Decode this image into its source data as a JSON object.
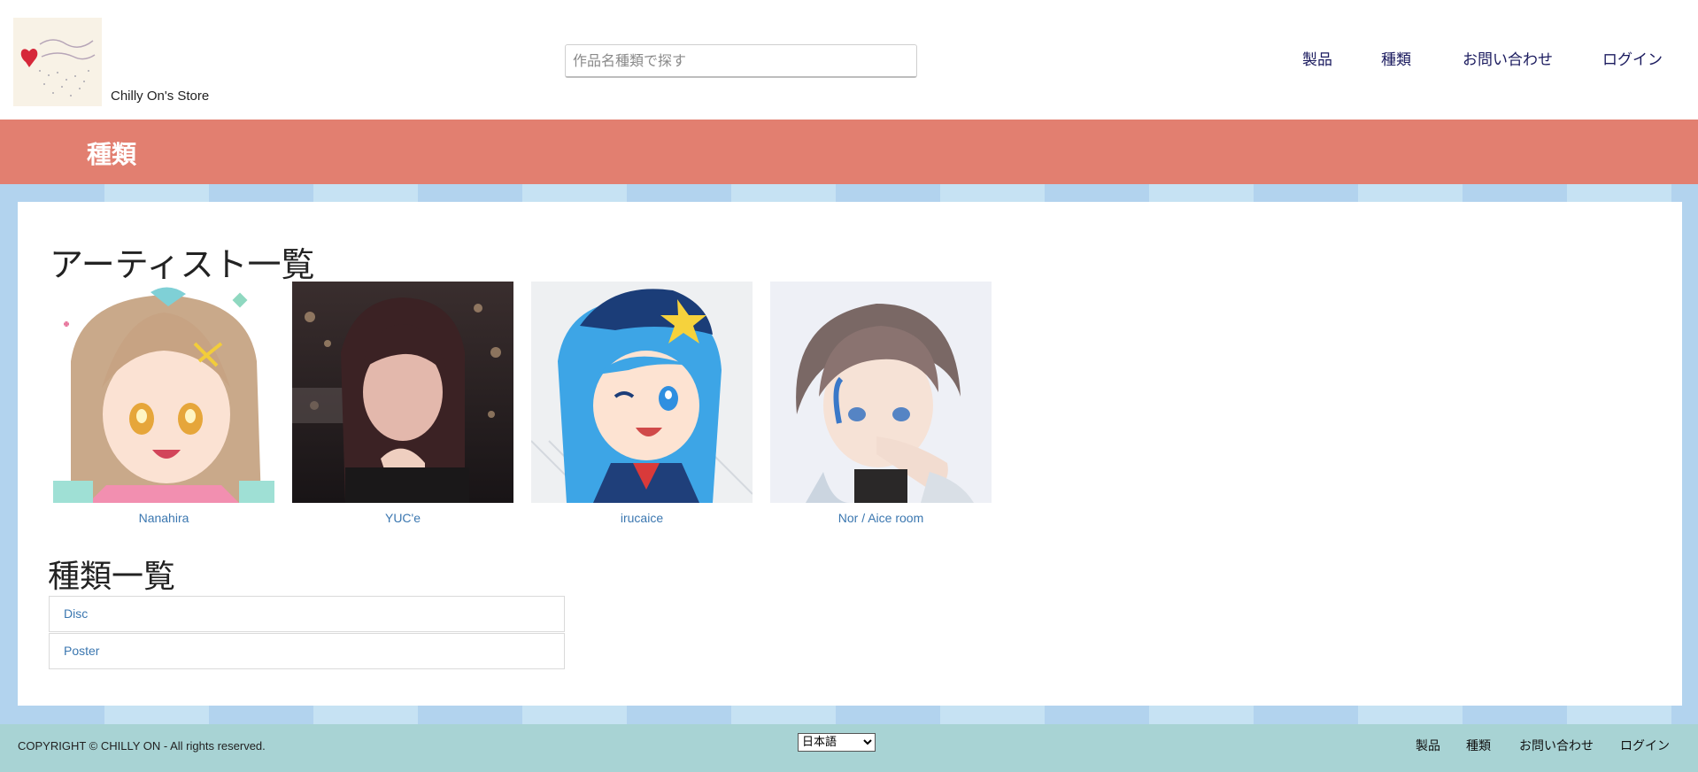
{
  "header": {
    "store_name": "Chilly On's Store",
    "search_placeholder": "作品名種類で探す",
    "nav": [
      "製品",
      "種類",
      "お問い合わせ",
      "ログイン"
    ]
  },
  "page": {
    "title": "種類",
    "artists_heading": "アーティスト一覧",
    "categories_heading": "種類一覧"
  },
  "artists": [
    {
      "name": "Nanahira"
    },
    {
      "name": "YUC'e"
    },
    {
      "name": "irucaice"
    },
    {
      "name": "Nor / Aice room"
    }
  ],
  "categories": [
    "Disc",
    "Poster"
  ],
  "footer": {
    "copyright": "COPYRIGHT © CHILLY ON - All rights reserved.",
    "language": "日本語",
    "nav": [
      "製品",
      "種類",
      "お問い合わせ",
      "ログイン"
    ]
  },
  "colors": {
    "banner": "#e27f70",
    "footer": "#a8d3d4",
    "link": "#3b77b0",
    "nav": "#1a1a5e"
  }
}
